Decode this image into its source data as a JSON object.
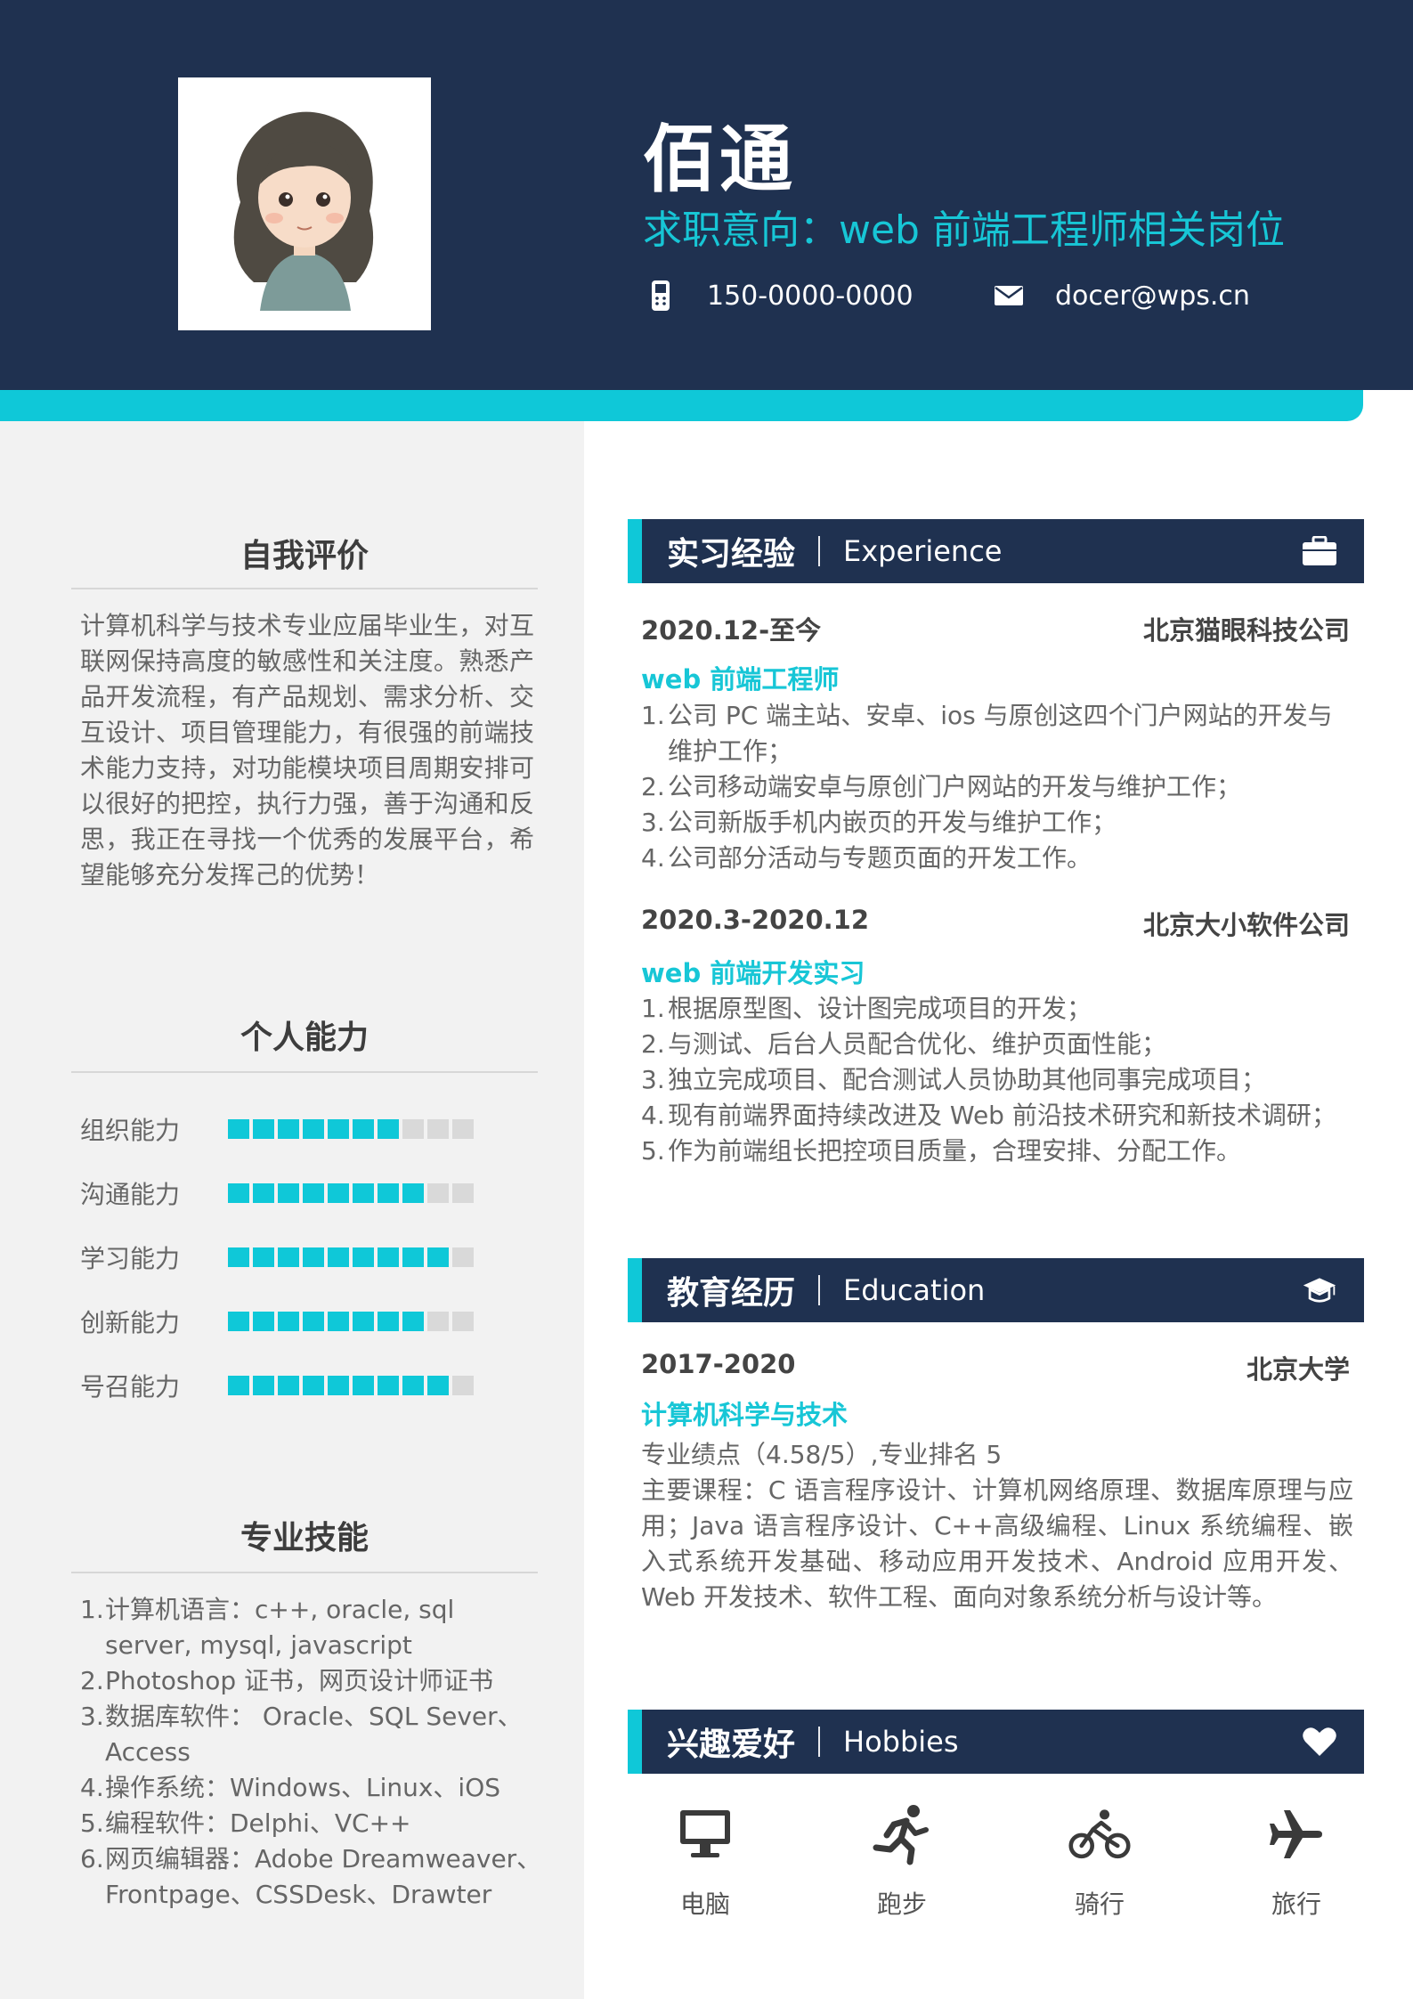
{
  "header": {
    "name": "佰通",
    "objective": "求职意向：web 前端工程师相关岗位",
    "phone": "150-0000-0000",
    "email": "docer@wps.cn"
  },
  "self_eval": {
    "title": "自我评价",
    "text": "计算机科学与技术专业应届毕业生，对互联网保持高度的敏感性和关注度。熟悉产品开发流程，有产品规划、需求分析、交互设计、项目管理能力，有很强的前端技术能力支持，对功能模块项目周期安排可以很好的把控，执行力强，善于沟通和反思，我正在寻找一个优秀的发展平台，希望能够充分发挥己的优势！"
  },
  "abilities": {
    "title": "个人能力",
    "total": 10,
    "items": [
      {
        "name": "组织能力",
        "level": 7
      },
      {
        "name": "沟通能力",
        "level": 8
      },
      {
        "name": "学习能力",
        "level": 9
      },
      {
        "name": "创新能力",
        "level": 8
      },
      {
        "name": "号召能力",
        "level": 9
      }
    ]
  },
  "pro_skills": {
    "title": "专业技能",
    "items": [
      {
        "num": "1.",
        "text": "计算机语言：c++, oracle, sql server, mysql, javascript"
      },
      {
        "num": "2.",
        "text": "Photoshop 证书，网页设计师证书"
      },
      {
        "num": "3.",
        "text": "数据库软件： Oracle、SQL Sever、Access"
      },
      {
        "num": "4.",
        "text": "操作系统：Windows、Linux、iOS"
      },
      {
        "num": "5.",
        "text": "编程软件：Delphi、VC++"
      },
      {
        "num": "6.",
        "text": "网页编辑器：Adobe Dreamweaver、Frontpage、CSSDesk、Drawter"
      }
    ]
  },
  "experience": {
    "title_zh": "实习经验",
    "title_en": "Experience",
    "jobs": [
      {
        "period": "2020.12-至今",
        "company": "北京猫眼科技公司",
        "role": "web 前端工程师",
        "items": [
          {
            "num": "1.",
            "text": "公司 PC 端主站、安卓、ios 与原创这四个门户网站的开发与维护工作；"
          },
          {
            "num": "2.",
            "text": "公司移动端安卓与原创门户网站的开发与维护工作；"
          },
          {
            "num": "3.",
            "text": "公司新版手机内嵌页的开发与维护工作；"
          },
          {
            "num": "4.",
            "text": "公司部分活动与专题页面的开发工作。"
          }
        ]
      },
      {
        "period": "2020.3-2020.12",
        "company": "北京大小软件公司",
        "role": "web 前端开发实习",
        "items": [
          {
            "num": "1.",
            "text": "根据原型图、设计图完成项目的开发；"
          },
          {
            "num": "2.",
            "text": "与测试、后台人员配合优化、维护页面性能；"
          },
          {
            "num": "3.",
            "text": "独立完成项目、配合测试人员协助其他同事完成项目；"
          },
          {
            "num": "4.",
            "text": "现有前端界面持续改进及 Web 前沿技术研究和新技术调研；"
          },
          {
            "num": "5.",
            "text": "作为前端组长把控项目质量，合理安排、分配工作。"
          }
        ]
      }
    ]
  },
  "education": {
    "title_zh": "教育经历",
    "title_en": "Education",
    "period": "2017-2020",
    "school": "北京大学",
    "major": "计算机科学与技术",
    "gpa": "专业绩点（4.58/5）,专业排名 5",
    "courses": "主要课程：C 语言程序设计、计算机网络原理、数据库原理与应用；Java 语言程序设计、C++高级编程、Linux 系统编程、嵌入式系统开发基础、移动应用开发技术、Android 应用开发、Web 开发技术、软件工程、面向对象系统分析与设计等。"
  },
  "hobbies": {
    "title_zh": "兴趣爱好",
    "title_en": "Hobbies",
    "items": [
      {
        "label": "电脑",
        "icon": "computer-icon"
      },
      {
        "label": "跑步",
        "icon": "running-icon"
      },
      {
        "label": "骑行",
        "icon": "bicycle-icon"
      },
      {
        "label": "旅行",
        "icon": "airplane-icon"
      }
    ]
  },
  "colors": {
    "navy": "#1f3150",
    "cyan": "#0fc8d8",
    "left_bg": "#f2f2f2"
  }
}
